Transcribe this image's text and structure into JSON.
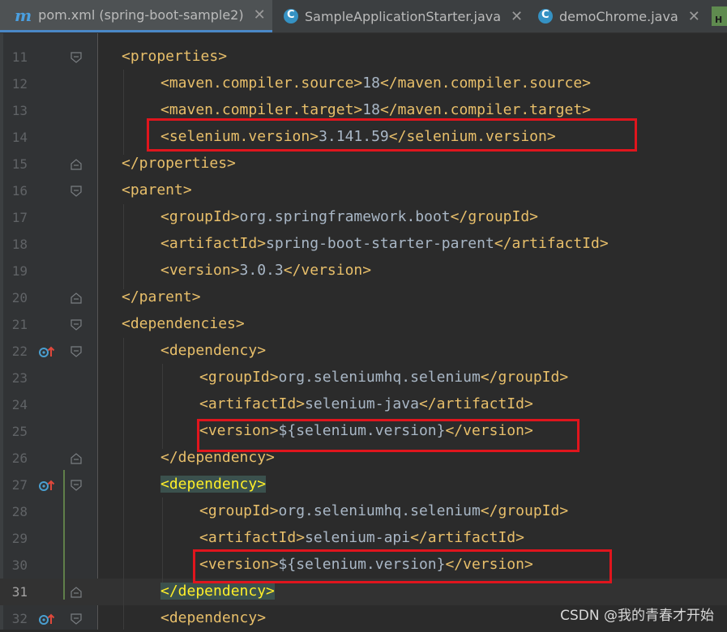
{
  "tabs": [
    {
      "label": "pom.xml (spring-boot-sample2)",
      "icon": "maven-icon",
      "active": true
    },
    {
      "label": "SampleApplicationStarter.java",
      "icon": "java-class-icon",
      "active": false
    },
    {
      "label": "demoChrome.java",
      "icon": "java-class-icon",
      "active": false
    }
  ],
  "close_glyph": "✕",
  "overflow_tab_letter": "H",
  "lines": [
    {
      "num": "11",
      "indent": 0,
      "segments": [
        {
          "t": "<properties>",
          "c": "tag"
        }
      ],
      "fold": "open"
    },
    {
      "num": "12",
      "indent": 1,
      "segments": [
        {
          "t": "<maven.compiler.source>",
          "c": "tag"
        },
        {
          "t": "18",
          "c": "txt"
        },
        {
          "t": "</maven.compiler.source>",
          "c": "tag"
        }
      ]
    },
    {
      "num": "13",
      "indent": 1,
      "segments": [
        {
          "t": "<maven.compiler.target>",
          "c": "tag"
        },
        {
          "t": "18",
          "c": "txt"
        },
        {
          "t": "</maven.compiler.target>",
          "c": "tag"
        }
      ]
    },
    {
      "num": "14",
      "indent": 1,
      "segments": [
        {
          "t": "<selenium.version>",
          "c": "tag"
        },
        {
          "t": "3.141.59",
          "c": "txt"
        },
        {
          "t": "</selenium.version>",
          "c": "tag"
        }
      ]
    },
    {
      "num": "15",
      "indent": 0,
      "segments": [
        {
          "t": "</properties>",
          "c": "tag"
        }
      ],
      "fold": "close"
    },
    {
      "num": "16",
      "indent": 0,
      "segments": [
        {
          "t": "<parent>",
          "c": "tag"
        }
      ],
      "fold": "open"
    },
    {
      "num": "17",
      "indent": 1,
      "segments": [
        {
          "t": "<groupId>",
          "c": "tag"
        },
        {
          "t": "org.springframework.boot",
          "c": "txt"
        },
        {
          "t": "</groupId>",
          "c": "tag"
        }
      ]
    },
    {
      "num": "18",
      "indent": 1,
      "segments": [
        {
          "t": "<artifactId>",
          "c": "tag"
        },
        {
          "t": "spring-boot-starter-parent",
          "c": "txt"
        },
        {
          "t": "</artifactId>",
          "c": "tag"
        }
      ]
    },
    {
      "num": "19",
      "indent": 1,
      "segments": [
        {
          "t": "<version>",
          "c": "tag"
        },
        {
          "t": "3.0.3",
          "c": "txt"
        },
        {
          "t": "</version>",
          "c": "tag"
        }
      ]
    },
    {
      "num": "20",
      "indent": 0,
      "segments": [
        {
          "t": "</parent>",
          "c": "tag"
        }
      ],
      "fold": "close"
    },
    {
      "num": "21",
      "indent": 0,
      "segments": [
        {
          "t": "<dependencies>",
          "c": "tag"
        }
      ],
      "fold": "open"
    },
    {
      "num": "22",
      "indent": 1,
      "segments": [
        {
          "t": "<dependency>",
          "c": "tag"
        }
      ],
      "fold": "open",
      "gutter_icon": true
    },
    {
      "num": "23",
      "indent": 2,
      "segments": [
        {
          "t": "<groupId>",
          "c": "tag"
        },
        {
          "t": "org.seleniumhq.selenium",
          "c": "txt"
        },
        {
          "t": "</groupId>",
          "c": "tag"
        }
      ]
    },
    {
      "num": "24",
      "indent": 2,
      "segments": [
        {
          "t": "<artifactId>",
          "c": "tag"
        },
        {
          "t": "selenium-java",
          "c": "txt"
        },
        {
          "t": "</artifactId>",
          "c": "tag"
        }
      ]
    },
    {
      "num": "25",
      "indent": 2,
      "segments": [
        {
          "t": "<version>",
          "c": "tag"
        },
        {
          "t": "${selenium.version}",
          "c": "txt"
        },
        {
          "t": "</version>",
          "c": "tag"
        }
      ]
    },
    {
      "num": "26",
      "indent": 1,
      "segments": [
        {
          "t": "</dependency>",
          "c": "tag"
        }
      ],
      "fold": "close"
    },
    {
      "num": "27",
      "indent": 1,
      "segments": [
        {
          "t": "<dependency>",
          "c": "tag hl-cur"
        }
      ],
      "fold": "open",
      "gutter_icon": true
    },
    {
      "num": "28",
      "indent": 2,
      "segments": [
        {
          "t": "<groupId>",
          "c": "tag"
        },
        {
          "t": "org.seleniumhq.selenium",
          "c": "txt"
        },
        {
          "t": "</groupId>",
          "c": "tag"
        }
      ]
    },
    {
      "num": "29",
      "indent": 2,
      "segments": [
        {
          "t": "<artifactId>",
          "c": "tag"
        },
        {
          "t": "selenium-api",
          "c": "txt"
        },
        {
          "t": "</artifactId>",
          "c": "tag"
        }
      ]
    },
    {
      "num": "30",
      "indent": 2,
      "segments": [
        {
          "t": "<version>",
          "c": "tag"
        },
        {
          "t": "${selenium.version}",
          "c": "txt"
        },
        {
          "t": "</version>",
          "c": "tag"
        }
      ]
    },
    {
      "num": "31",
      "indent": 1,
      "segments": [
        {
          "t": "</dependency>",
          "c": "tag hl-cur"
        }
      ],
      "fold": "close",
      "current": true
    },
    {
      "num": "32",
      "indent": 1,
      "segments": [
        {
          "t": "<dependency>",
          "c": "tag"
        }
      ],
      "fold": "open",
      "gutter_icon": true
    }
  ],
  "highlighted_lines": [
    "14",
    "25",
    "30"
  ],
  "watermark": "CSDN @我的青春才开始",
  "colors": {
    "tag": "#e8bf6a",
    "text": "#a9b7c6",
    "highlight": "#e0151d",
    "background": "#2b2b2b"
  }
}
